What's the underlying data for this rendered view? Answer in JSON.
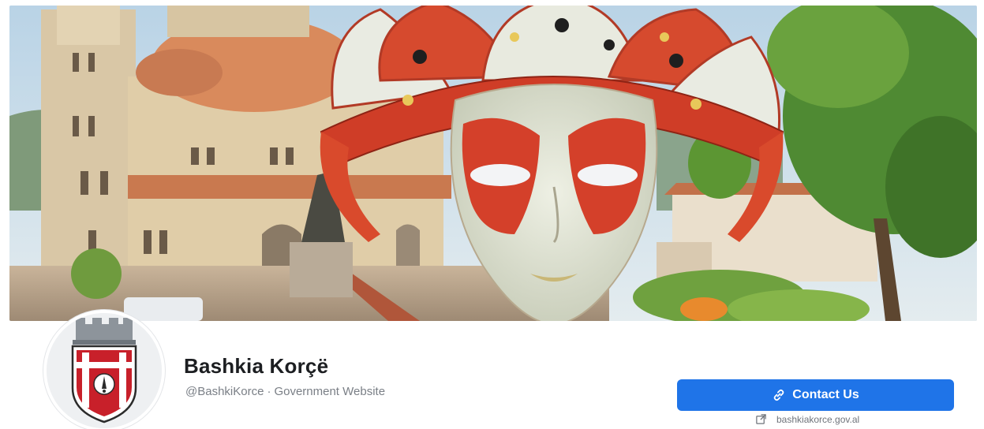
{
  "cover": {
    "alt": "Cover photo: carnival mask in front of the cathedral of Korçë"
  },
  "profile": {
    "name": "Bashkia Korçë",
    "handle": "@BashkiKorce",
    "separator": "·",
    "category": "Government Website"
  },
  "actions": {
    "contact_label": "Contact Us",
    "website": "bashkiakorce.gov.al"
  },
  "colors": {
    "accent": "#1f74e8",
    "name_text": "#1c1e21",
    "sub_text": "#7a7f86",
    "crest_red": "#c8202a"
  },
  "icons": {
    "contact": "link-icon",
    "website": "external-link-icon"
  }
}
